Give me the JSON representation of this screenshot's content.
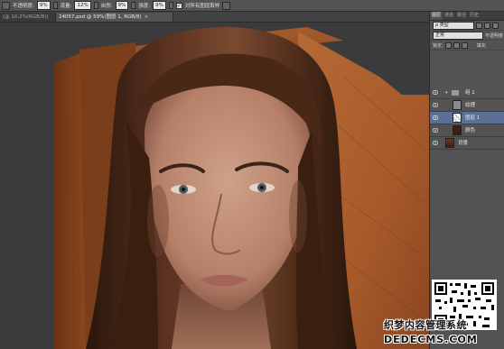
{
  "options_bar": {
    "opacity_label": "不透明度:",
    "opacity_value": "9%",
    "flow_label": "流量:",
    "flow_value": "12%",
    "vibrance_label": "自然:",
    "vibrance_value": "9%",
    "strength_label": "强度:",
    "strength_value": "9%",
    "sample_all_layers_label": "对所有图层取样"
  },
  "tabs": [
    {
      "label": "(@ 10.2%(RGB/8))",
      "close": "×"
    },
    {
      "label": "24057.psd @ 59%(图层 1, RGB/8)",
      "close": "×"
    }
  ],
  "layers_panel": {
    "tabs": [
      "图层",
      "通道",
      "路径",
      "历史"
    ],
    "filter": "ρ 类型",
    "blend_mode": "正常",
    "opacity_label": "不透明度",
    "lock_label": "锁定:",
    "fill_label": "填充",
    "layers": [
      {
        "name": "组 1",
        "type": "group",
        "selected": false
      },
      {
        "name": "纹理",
        "type": "layer",
        "selected": false
      },
      {
        "name": "图层 1",
        "type": "layer",
        "selected": true
      },
      {
        "name": "颜色",
        "type": "layer",
        "selected": false
      },
      {
        "name": "背景",
        "type": "layer",
        "selected": false
      }
    ]
  },
  "watermark": {
    "line1": "织梦内容管理系统",
    "line2": "DEDECMS.COM"
  },
  "colors": {
    "panel_bg": "#535353",
    "selected_layer": "#5b7094",
    "canvas_bg": "#3a3a3a",
    "wood": "#8a4a22"
  }
}
